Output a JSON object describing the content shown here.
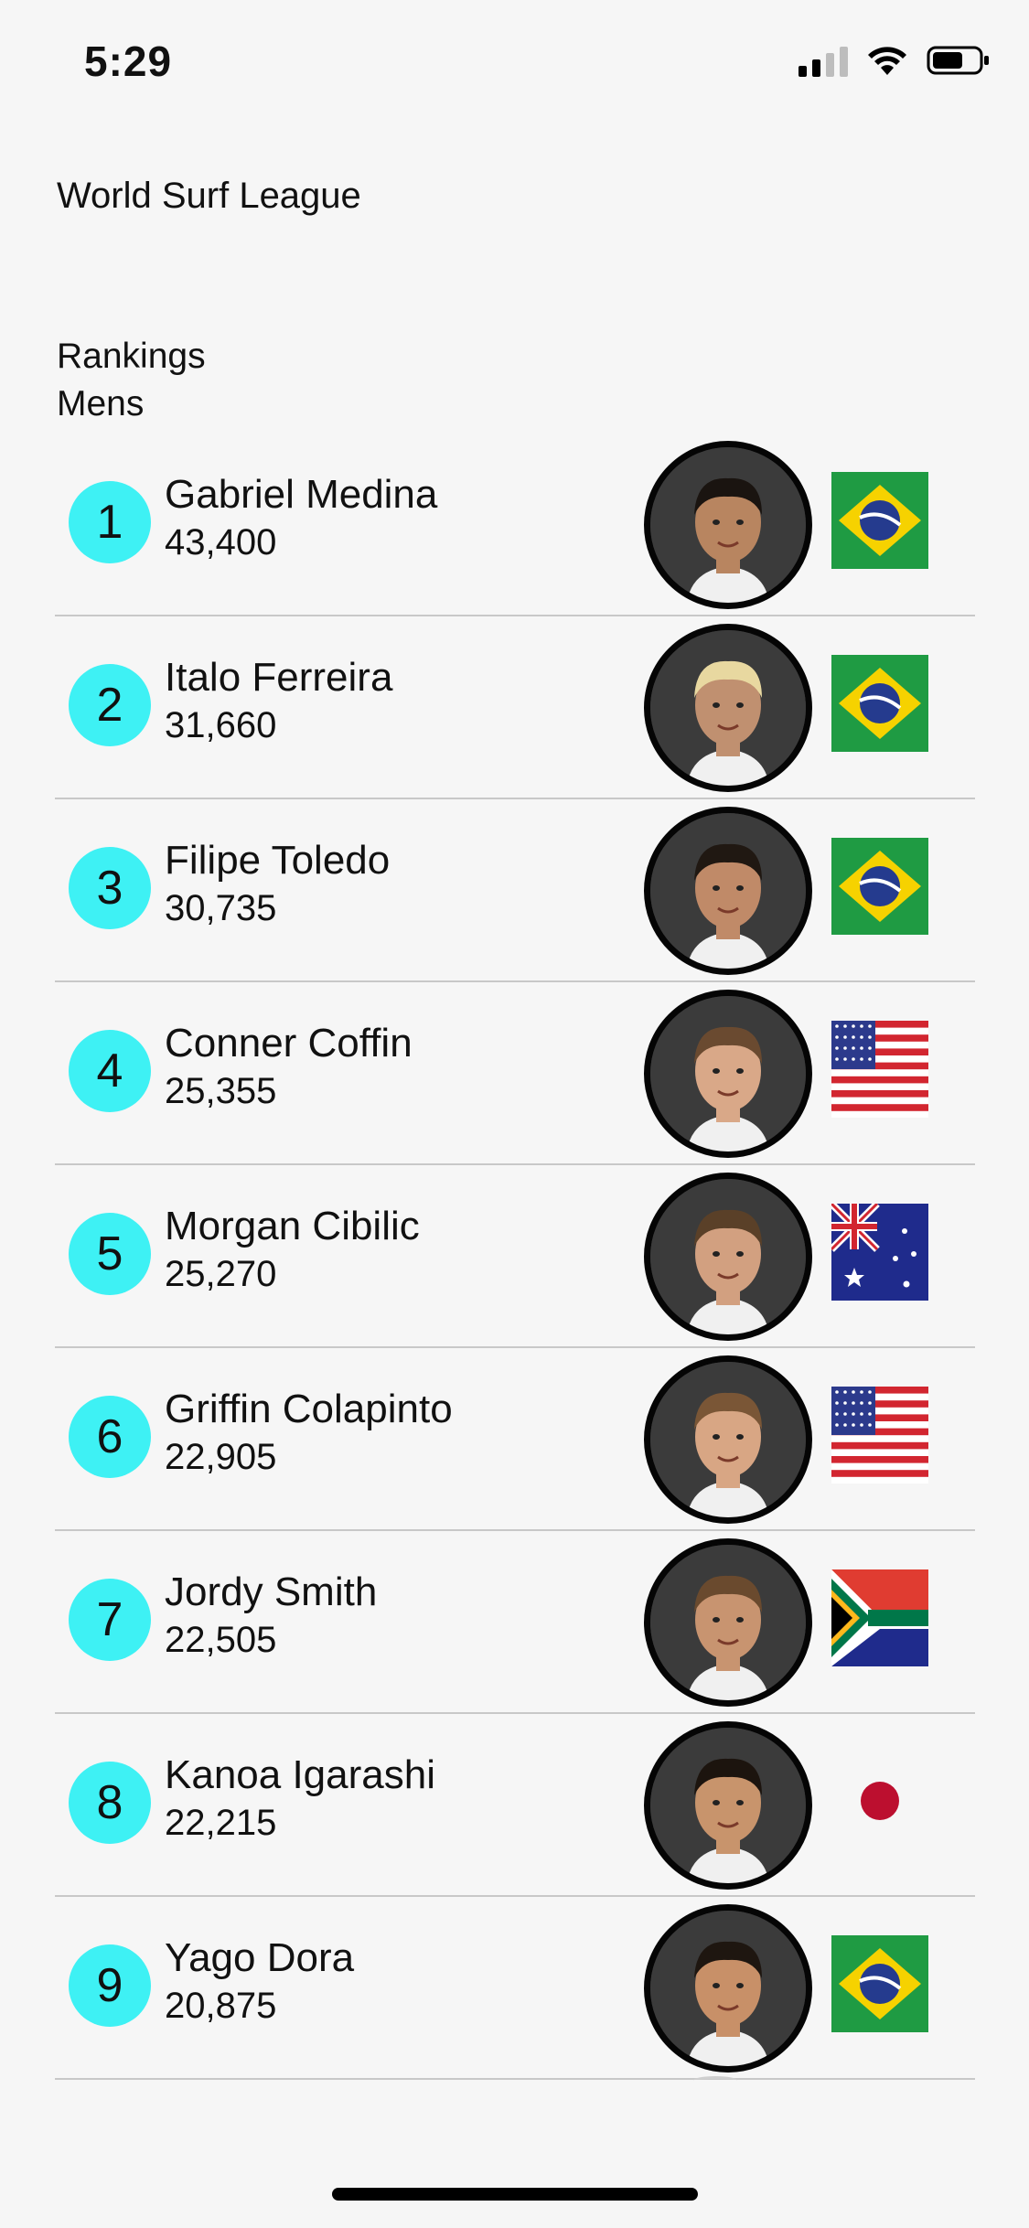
{
  "status_bar": {
    "time": "5:29"
  },
  "app": {
    "title": "World Surf League"
  },
  "section": {
    "heading": "Rankings",
    "subheading": "Mens"
  },
  "colors": {
    "rank_badge": "#3ef1f4",
    "divider": "#c8c8c8",
    "background": "#f6f6f6"
  },
  "rankings": [
    {
      "rank": "1",
      "name": "Gabriel Medina",
      "points": "43,400",
      "country": "brazil-flag",
      "skin": "#b88560",
      "hair": "#1a1410"
    },
    {
      "rank": "2",
      "name": "Italo Ferreira",
      "points": "31,660",
      "country": "brazil-flag",
      "skin": "#c09070",
      "hair": "#e8d8a0"
    },
    {
      "rank": "3",
      "name": "Filipe Toledo",
      "points": "30,735",
      "country": "brazil-flag",
      "skin": "#c08a68",
      "hair": "#201812"
    },
    {
      "rank": "4",
      "name": "Conner Coffin",
      "points": "25,355",
      "country": "usa-flag",
      "skin": "#d9a888",
      "hair": "#6a4a30"
    },
    {
      "rank": "5",
      "name": "Morgan Cibilic",
      "points": "25,270",
      "country": "australia-flag",
      "skin": "#d2a080",
      "hair": "#5a4028"
    },
    {
      "rank": "6",
      "name": "Griffin Colapinto",
      "points": "22,905",
      "country": "usa-flag",
      "skin": "#d8a684",
      "hair": "#7a5636"
    },
    {
      "rank": "7",
      "name": "Jordy Smith",
      "points": "22,505",
      "country": "south-africa-flag",
      "skin": "#c89470",
      "hair": "#6a4a2e"
    },
    {
      "rank": "8",
      "name": "Kanoa Igarashi",
      "points": "22,215",
      "country": "japan-flag",
      "skin": "#c8946c",
      "hair": "#1c140e"
    },
    {
      "rank": "9",
      "name": "Yago Dora",
      "points": "20,875",
      "country": "brazil-flag",
      "skin": "#c89068",
      "hair": "#1e1610"
    }
  ]
}
